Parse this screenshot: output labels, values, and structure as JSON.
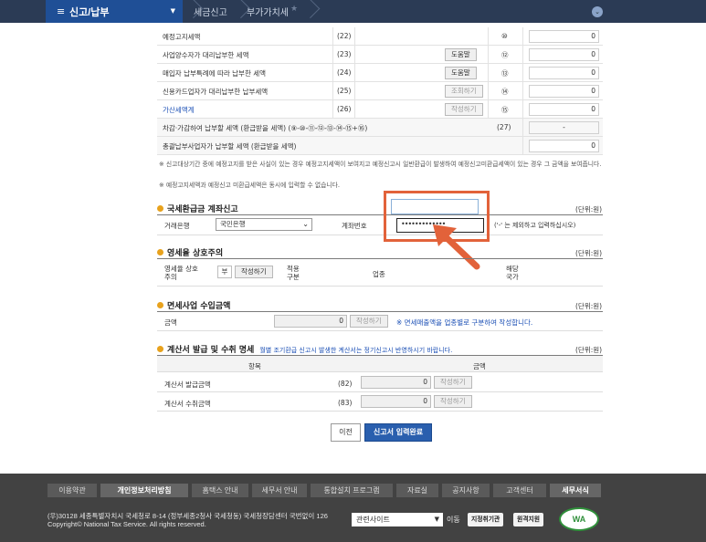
{
  "nav": {
    "menu_title": "신고/납부",
    "breadcrumbs": [
      "세금신고",
      "부가가치세"
    ]
  },
  "rows": [
    {
      "label": "예정고지세액",
      "code": "(22)",
      "circle": "⑩",
      "value": "0",
      "button": ""
    },
    {
      "label": "사업양수자가 대리납부한 세액",
      "code": "(23)",
      "circle": "⑫",
      "value": "0",
      "button": "도움말"
    },
    {
      "label": "매입자 납부특례에 따라 납부한 세액",
      "code": "(24)",
      "circle": "⑬",
      "value": "0",
      "button": "도움말"
    },
    {
      "label": "신용카드업자가 대리납부한 납부세액",
      "code": "(25)",
      "circle": "⑭",
      "value": "0",
      "button": "조회하기"
    },
    {
      "label": "가산세액계",
      "code": "(26)",
      "circle": "⑮",
      "value": "0",
      "button": "작성하기"
    }
  ],
  "row27": {
    "label": "차감·가감하여 납부할 세액 (환급받을 세액) (⑨-⑩-⑪-⑫-⑬-⑭-⑮+⑯)",
    "code": "(27)",
    "value": "-"
  },
  "row_total": {
    "label": "총괄납부사업자가 납부할 세액 (환급받을 세액)",
    "value": "0"
  },
  "notes": [
    "※ 신고대상기간 중에 예정고지를 받은 사실이 있는 경우 예정고지세액이 보여지고 예정신고시 일반환급이 발생하여 예정신고미환급세액이 있는 경우 그 금액을 보여줍니다.",
    "※ 예정고지세액과 예정신고 미환급세액은 동시에 입력할 수 없습니다."
  ],
  "refund": {
    "title": "국세환급금 계좌신고",
    "unit": "(단위:원)",
    "bank_label": "거래은행",
    "bank_value": "국민은행",
    "account_label": "계좌번호",
    "account_value": "•••••••••••••",
    "hint": "('-' 는 제외하고 입력하십시오)"
  },
  "zero_rate": {
    "title": "영세율 상호주의",
    "unit": "(단위:원)",
    "label": "영세율 상호주의",
    "value": "부",
    "button": "작성하기",
    "apply_label": "적용 구분",
    "biz_label": "업종",
    "country_label": "해당 국가"
  },
  "exempt": {
    "title": "면세사업 수입금액",
    "unit": "(단위:원)",
    "amount_label": "금액",
    "value": "0",
    "button": "작성하기",
    "note": "※ 면세매출액을 업종별로 구분하여 작성합니다."
  },
  "invoice": {
    "title": "계산서 발급 및 수취 명세",
    "subtitle": "월별 조기환급 신고시 발생한 계산서는 정기신고시 반영하시기 바랍니다.",
    "unit": "(단위:원)",
    "col_item": "항목",
    "col_amount": "금액",
    "rows": [
      {
        "label": "계산서 발급금액",
        "code": "(82)",
        "value": "0",
        "button": "작성하기"
      },
      {
        "label": "계산서 수취금액",
        "code": "(83)",
        "value": "0",
        "button": "작성하기"
      }
    ]
  },
  "actions": {
    "prev": "이전",
    "submit": "신고서 입력완료"
  },
  "footer": {
    "links": [
      "이용약관",
      "개인정보처리방침",
      "홈택스 안내",
      "세무서 안내",
      "통합설치 프로그램",
      "자료실",
      "공지사항",
      "고객센터",
      "세무서식"
    ],
    "address": "(우)30128 세종특별자치시 국세청로 8-14 (정부세종2청사 국세청동) 국세청장담센터 국번없이 126",
    "copyright": "Copyright© National Tax Service. All rights reserved.",
    "related": "관련사이트",
    "move": "이동",
    "badge1": "지정취기관",
    "badge2": "원격지원",
    "wa": "WA"
  }
}
